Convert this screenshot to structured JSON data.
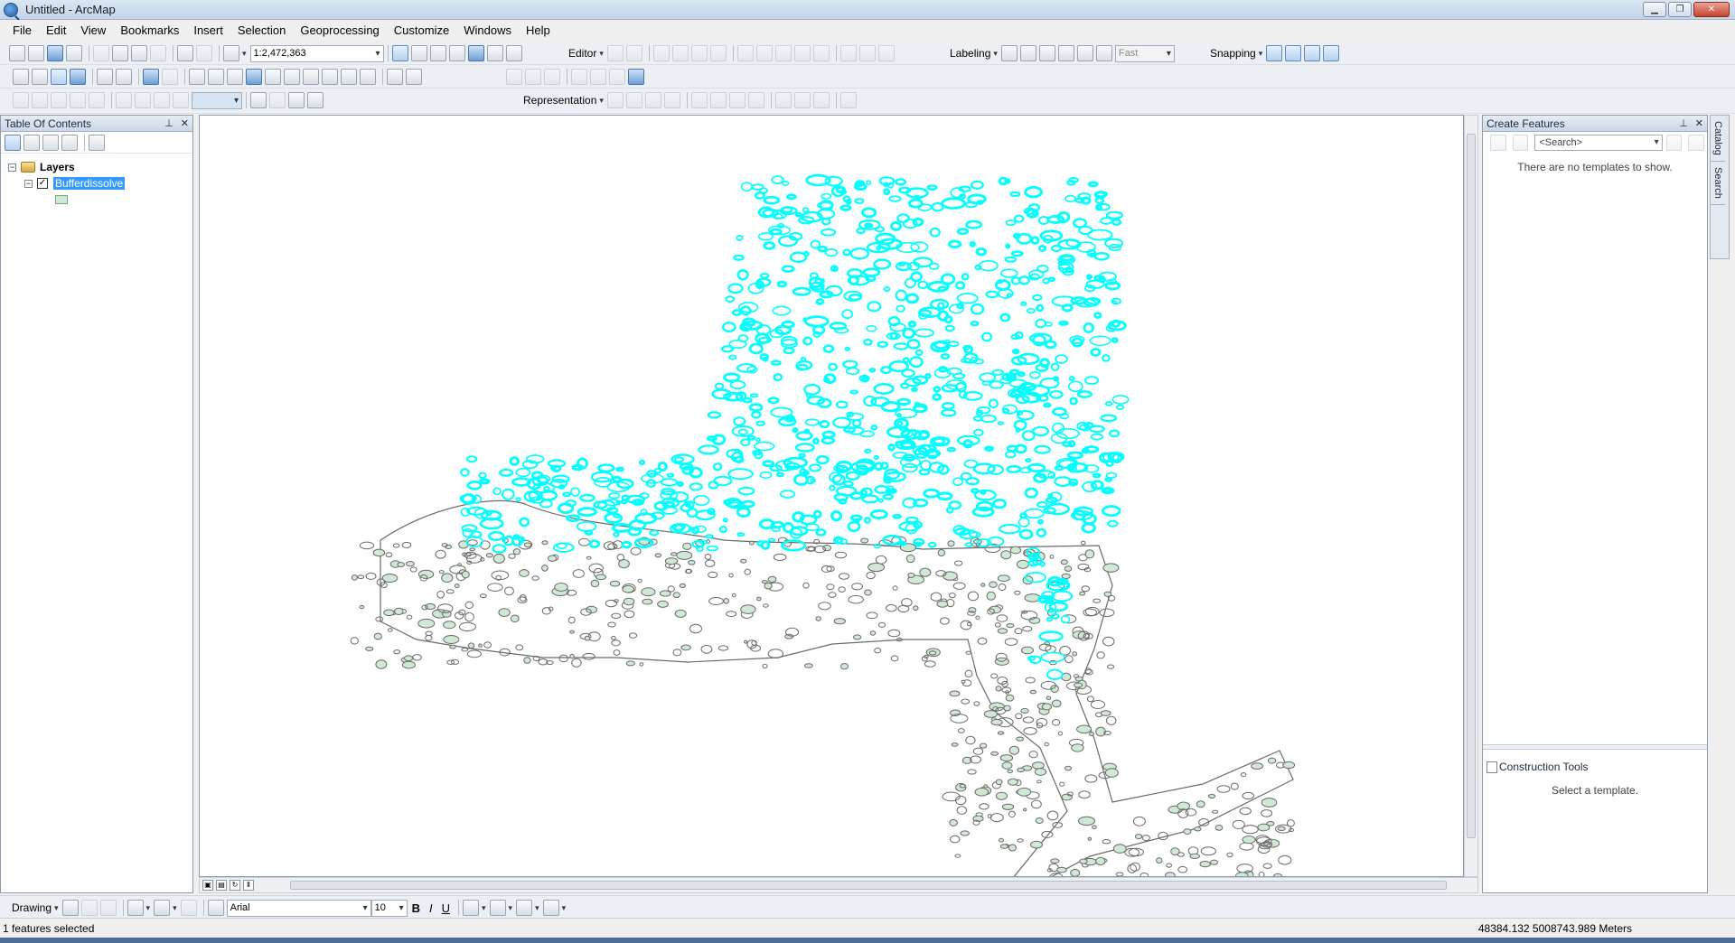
{
  "window": {
    "title": "Untitled - ArcMap"
  },
  "menu": [
    "File",
    "Edit",
    "View",
    "Bookmarks",
    "Insert",
    "Selection",
    "Geoprocessing",
    "Customize",
    "Windows",
    "Help"
  ],
  "toolbar": {
    "scale": "1:2,472,363",
    "editor_label": "Editor",
    "labeling_label": "Labeling",
    "label_quality": "Fast",
    "snapping_label": "Snapping",
    "representation_label": "Representation"
  },
  "toc": {
    "title": "Table Of Contents",
    "root": "Layers",
    "layer": {
      "name": "Bufferdissolve",
      "checked": true
    }
  },
  "create_features": {
    "title": "Create Features",
    "search_placeholder": "<Search>",
    "empty_message": "There are no templates to show.",
    "construction_title": "Construction Tools",
    "construction_empty": "Select a template."
  },
  "side_tabs": [
    "Catalog",
    "Search"
  ],
  "drawing": {
    "label": "Drawing",
    "font": "Arial",
    "size": "10",
    "bold": "B",
    "italic": "I",
    "underline": "U"
  },
  "status": {
    "left": "1 features selected",
    "coords": "48384.132  5008743.989 Meters"
  },
  "colors": {
    "selection": "#00ffff",
    "feature_fill": "#cfe9d4",
    "feature_outline": "#6a6a6a",
    "highlight": "#3399ff"
  }
}
